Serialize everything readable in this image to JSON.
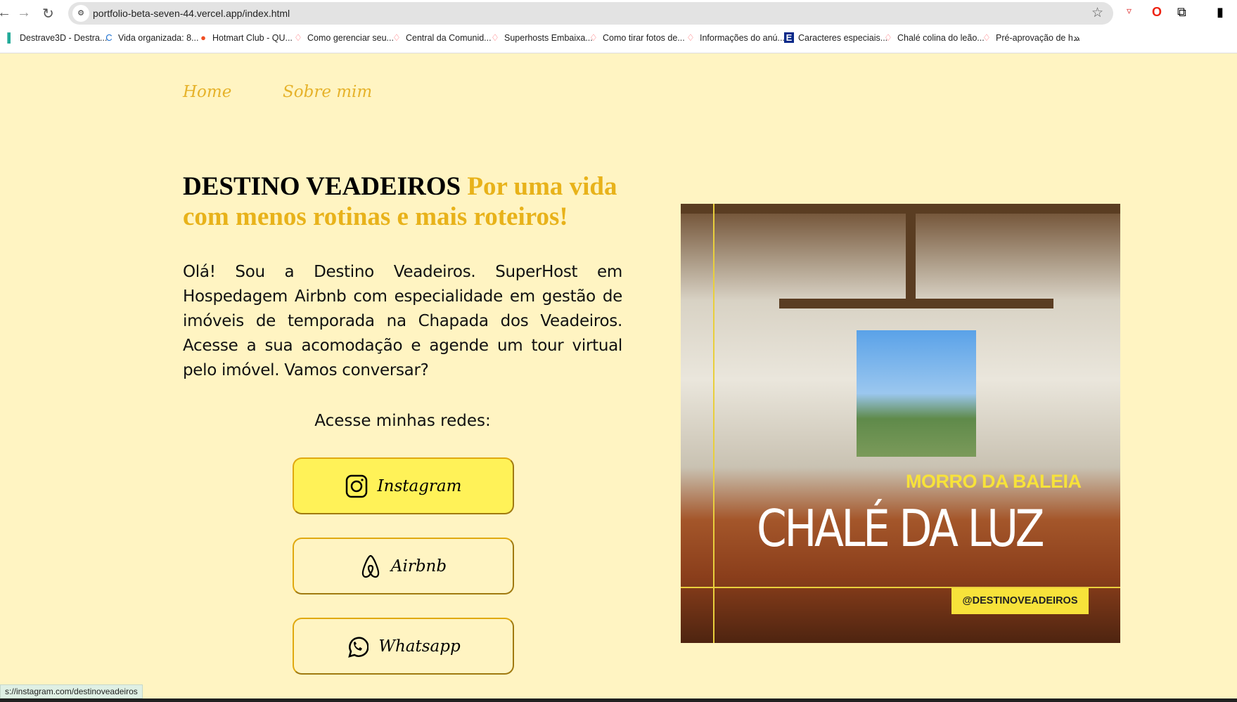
{
  "browser": {
    "url": "portfolio-beta-seven-44.vercel.app/index.html",
    "bookmarks": [
      {
        "label": "Destrave3D - Destra...",
        "icon": "green-bar-icon"
      },
      {
        "label": "Vida organizada: 8...",
        "icon": "c-logo-icon"
      },
      {
        "label": "Hotmart Club - QU...",
        "icon": "hotmart-flame-icon"
      },
      {
        "label": "Como gerenciar seu...",
        "icon": "airbnb-icon"
      },
      {
        "label": "Central da Comunid...",
        "icon": "airbnb-icon"
      },
      {
        "label": "Superhosts Embaixa...",
        "icon": "airbnb-icon"
      },
      {
        "label": "Como tirar fotos de...",
        "icon": "airbnb-icon"
      },
      {
        "label": "Informações do anú...",
        "icon": "airbnb-icon"
      },
      {
        "label": "Caracteres especiais...",
        "icon": "e-logo-icon"
      },
      {
        "label": "Chalé colina do leão...",
        "icon": "airbnb-icon"
      },
      {
        "label": "Pré-aprovação de h...",
        "icon": "airbnb-icon"
      }
    ],
    "more_bookmarks": "»",
    "status_url": "s://instagram.com/destinoveadeiros"
  },
  "nav": {
    "items": [
      "Home",
      "Sobre mim"
    ]
  },
  "hero_text": {
    "brand": "DESTINO VEADEIROS",
    "tagline": "Por uma vida com menos rotinas e mais roteiros!",
    "intro": "Olá! Sou a Destino Veadeiros. SuperHost em Hospedagem Airbnb com especialidade em gestão de imóveis de temporada na Chapada dos Veadeiros. Acesse a sua acomodação e agende um tour virtual pelo imóvel. Vamos conversar?"
  },
  "social": {
    "heading": "Acesse minhas redes:",
    "buttons": [
      {
        "label": "Instagram",
        "icon": "instagram-icon"
      },
      {
        "label": "Airbnb",
        "icon": "airbnb-icon"
      },
      {
        "label": "Whatsapp",
        "icon": "whatsapp-icon"
      }
    ]
  },
  "photo": {
    "subtitle": "MORRO DA  BALEIA",
    "title": "CHALÉ DA LUZ",
    "handle": "@DESTINOVEADEIROS"
  },
  "colors": {
    "background": "#fff4c2",
    "accent": "#e8b21a",
    "button_primary": "#fff258"
  }
}
